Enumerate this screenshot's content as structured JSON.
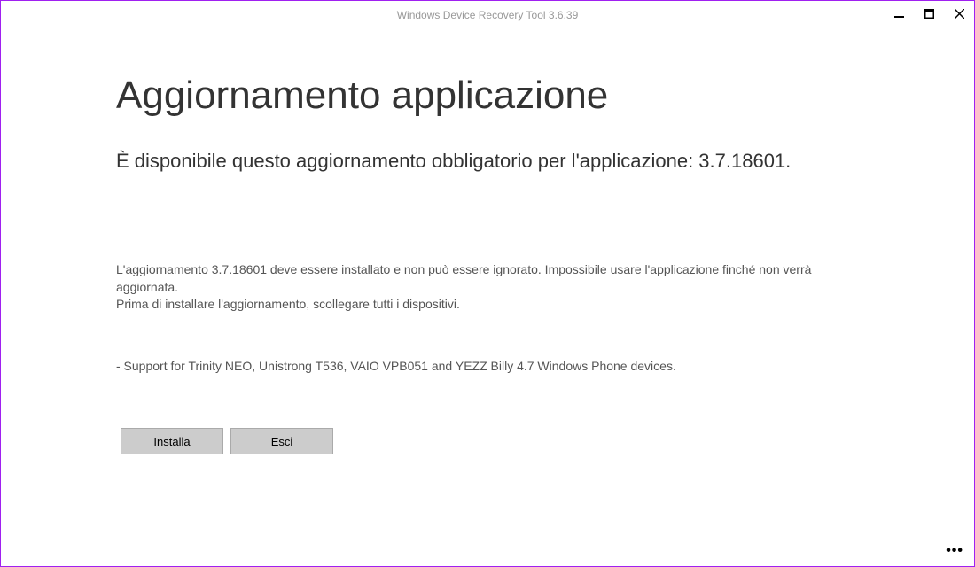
{
  "window": {
    "title": "Windows Device Recovery Tool 3.6.39"
  },
  "page": {
    "heading": "Aggiornamento applicazione",
    "subtitle": "È disponibile questo aggiornamento obbligatorio per l'applicazione: 3.7.18601.",
    "body_line1": "L'aggiornamento 3.7.18601 deve essere installato e non può essere ignorato. Impossibile usare l'applicazione finché non verrà aggiornata.",
    "body_line2": "Prima di installare l'aggiornamento, scollegare tutti i dispositivi.",
    "body_line3": "- Support for Trinity NEO, Unistrong T536, VAIO VPB051 and YEZZ Billy 4.7 Windows Phone devices."
  },
  "buttons": {
    "install": "Installa",
    "exit": "Esci"
  }
}
